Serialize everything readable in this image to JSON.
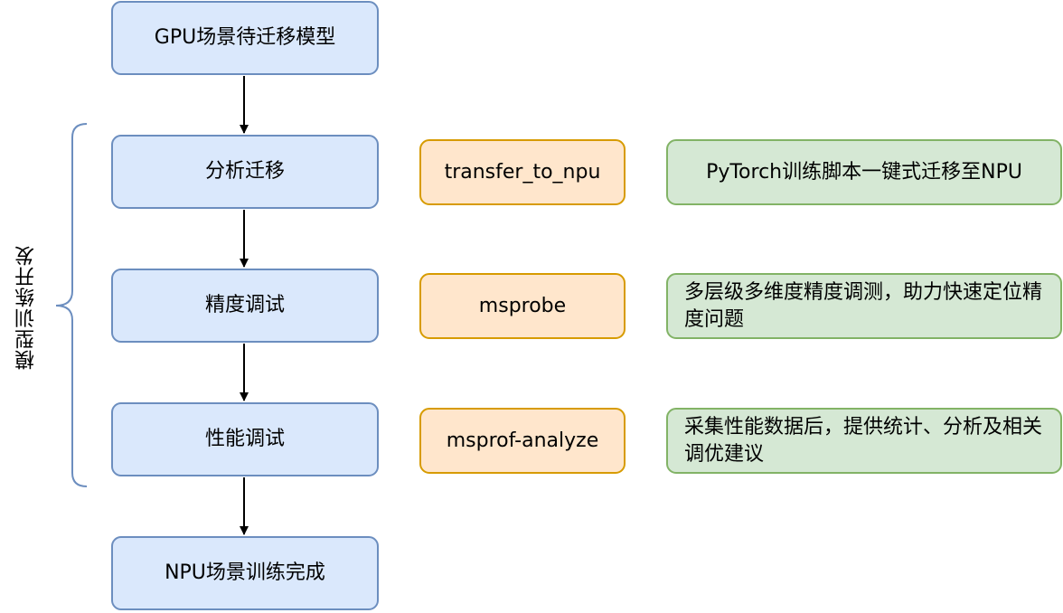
{
  "flow": {
    "start": "GPU场景待迁移模型",
    "step1": "分析迁移",
    "step2": "精度调试",
    "step3": "性能调试",
    "end": "NPU场景训练完成"
  },
  "tools": {
    "step1": "transfer_to_npu",
    "step2": "msprobe",
    "step3": "msprof-analyze"
  },
  "descriptions": {
    "step1": "PyTorch训练脚本一键式迁移至NPU",
    "step2": "多层级多维度精度调测，助力快速定位精度问题",
    "step3": "采集性能数据后，提供统计、分析及相关调优建议"
  },
  "group": {
    "label": "模型训练开发"
  },
  "colors": {
    "stage_fill": "#dae8fc",
    "stage_border": "#6c8ebf",
    "tool_fill": "#ffe6cc",
    "tool_border": "#d79b00",
    "desc_fill": "#d5e8d4",
    "desc_border": "#82b366",
    "brace": "#6c8ebf"
  }
}
